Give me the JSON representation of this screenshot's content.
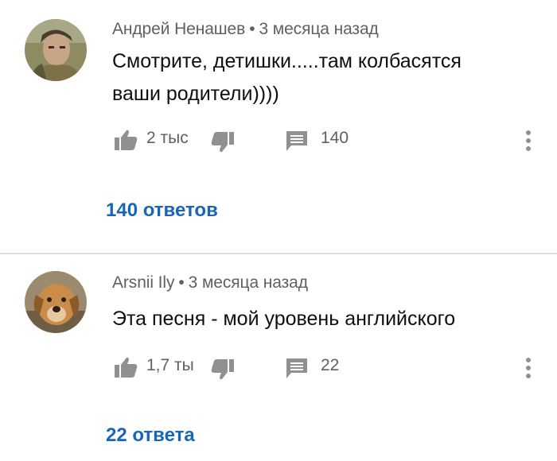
{
  "comments": [
    {
      "author": "Андрей Ненашев",
      "separator": "•",
      "time": "3 месяца назад",
      "text_line1": "Смотрите, детишки.....там колбасятся",
      "text_line2": "ваши родители))))",
      "likes": "2 тыс",
      "reply_count": "140",
      "replies_link": "140 ответов",
      "avatar_icon": "person-photo-avatar"
    },
    {
      "author": "Arsnii Ily",
      "separator": "•",
      "time": "3 месяца назад",
      "text_line1": "Эта песня - мой уровень английского",
      "likes": "1,7 ты",
      "reply_count": "22",
      "replies_link": "22 ответа",
      "avatar_icon": "dog-photo-avatar"
    }
  ],
  "colors": {
    "meta": "#606060",
    "text": "#0f0f0f",
    "link": "#1a65b8",
    "icon": "#909090",
    "divider": "#dcdcdc"
  }
}
